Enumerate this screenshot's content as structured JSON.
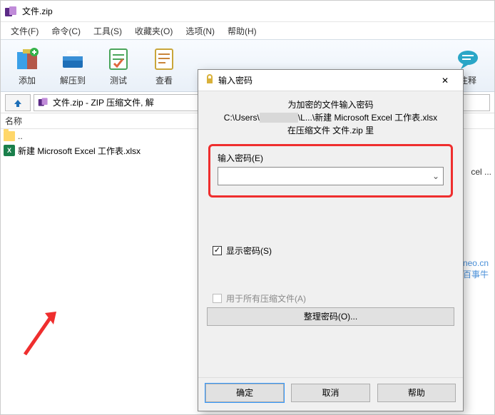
{
  "window": {
    "title": "文件.zip"
  },
  "menu": {
    "file": "文件(F)",
    "commands": "命令(C)",
    "tools": "工具(S)",
    "favorites": "收藏夹(O)",
    "options": "选项(N)",
    "help": "帮助(H)"
  },
  "toolbar": {
    "add": "添加",
    "extract": "解压到",
    "test": "测试",
    "view": "查看",
    "comment": "注释"
  },
  "pathbar": {
    "text": "文件.zip - ZIP 压缩文件, 解"
  },
  "columns": {
    "name": "名称"
  },
  "files": {
    "updir": "..",
    "item1": "新建 Microsoft Excel 工作表.xlsx"
  },
  "right_fragment": "cel ...",
  "watermark": {
    "line1": "passneo.cn",
    "line2": "百事牛"
  },
  "dialog": {
    "title": "输入密码",
    "info1": "为加密的文件输入密码",
    "info2a": "C:\\Users\\",
    "info2b": "\\L...\\新建 Microsoft Excel 工作表.xlsx",
    "info3": "在压缩文件 文件.zip 里",
    "field_label": "输入密码(E)",
    "show_password": "显示密码(S)",
    "use_all": "用于所有压缩文件(A)",
    "organize": "整理密码(O)...",
    "ok": "确定",
    "cancel": "取消",
    "help": "帮助",
    "password_value": ""
  }
}
